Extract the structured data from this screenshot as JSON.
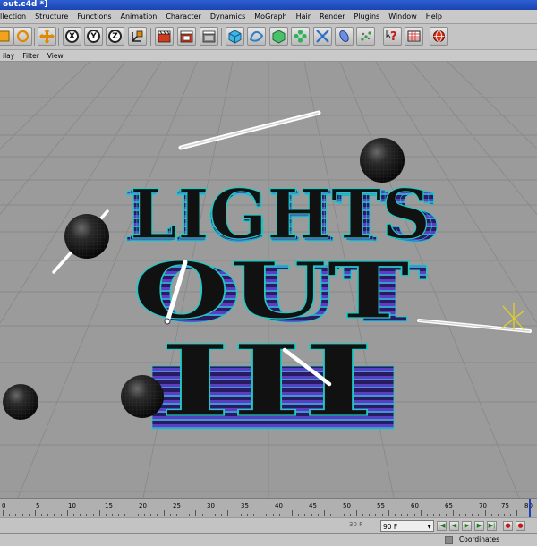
{
  "window": {
    "title": "out.c4d *]"
  },
  "menu": [
    "llection",
    "Structure",
    "Functions",
    "Animation",
    "Character",
    "Dynamics",
    "MoGraph",
    "Hair",
    "Render",
    "Plugins",
    "Window",
    "Help"
  ],
  "toolbar": {
    "axis_x": "X",
    "axis_y": "Y",
    "axis_z": "Z"
  },
  "view_menu": [
    "ilay",
    "Filter",
    "View"
  ],
  "scene": {
    "title_line1": "LIGHTS",
    "title_line2": "OUT",
    "title_line3": "III"
  },
  "timeline": {
    "ticks": [
      "0",
      "5",
      "10",
      "15",
      "20",
      "25",
      "30",
      "35",
      "40",
      "45",
      "50",
      "55",
      "60",
      "65",
      "70",
      "75",
      "80"
    ],
    "start_frame": "30 F",
    "end_frame": "90 F"
  },
  "status": {
    "panel_label": "Coordinates"
  },
  "colors": {
    "accent": "#1b44b0",
    "text_blue": "#4a2b9e",
    "text_teal": "#22c9c4",
    "grid": "#9a9a9a"
  }
}
